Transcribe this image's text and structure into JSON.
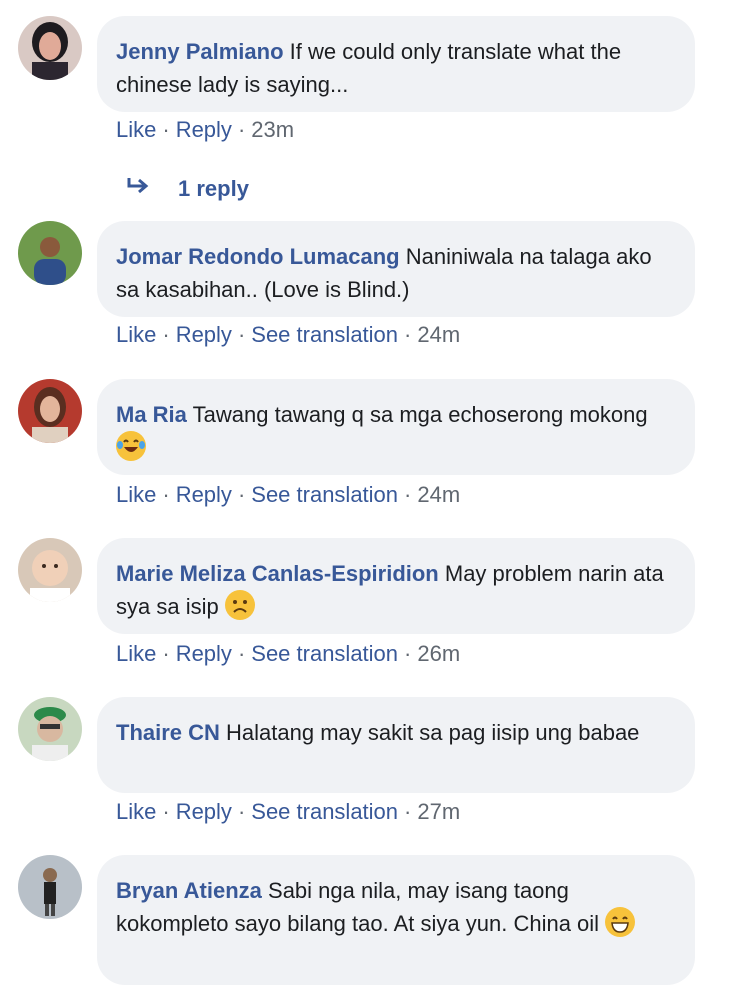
{
  "comments": [
    {
      "author": "Jenny Palmiano",
      "text": "If we could only translate what the chinese lady is saying...",
      "like": "Like",
      "reply": "Reply",
      "translate": "",
      "time": "23m",
      "emoji": ""
    },
    {
      "author": "Jomar Redondo Lumacang",
      "text": "Naniniwala na talaga ako sa kasabihan.. (Love is Blind.)",
      "like": "Like",
      "reply": "Reply",
      "translate": "See translation",
      "time": "24m",
      "emoji": ""
    },
    {
      "author": "Ma Ria",
      "text": "Tawang tawang q sa mga echoserong mokong",
      "like": "Like",
      "reply": "Reply",
      "translate": "See translation",
      "time": "24m",
      "emoji": "tears-of-joy-emoji"
    },
    {
      "author": "Marie Meliza Canlas-Espiridion",
      "text": "May problem narin ata sya sa isip",
      "like": "Like",
      "reply": "Reply",
      "translate": "See translation",
      "time": "26m",
      "emoji": "sad-face-emoji"
    },
    {
      "author": "Thaire CN",
      "text": "Halatang may sakit sa pag iisip ung babae",
      "like": "Like",
      "reply": "Reply",
      "translate": "See translation",
      "time": "27m",
      "emoji": ""
    },
    {
      "author": "Bryan Atienza",
      "text": "Sabi nga nila, may isang taong kokompleto sayo bilang tao. At siya yun. China oil",
      "like": "",
      "reply": "",
      "translate": "",
      "time": "",
      "emoji": "grinning-emoji"
    }
  ],
  "replies_link": {
    "label": "1 reply",
    "icon": "reply-arrow-icon"
  },
  "colors": {
    "link": "#385898",
    "meta": "#606770",
    "bubble": "#f0f2f5",
    "text": "#1c1e21"
  }
}
